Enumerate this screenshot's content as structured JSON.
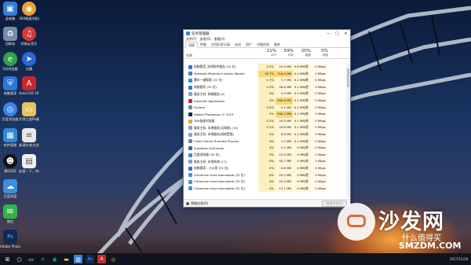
{
  "desktop_icons": [
    {
      "label": "此电脑",
      "icon": "computer-icon",
      "color": "#2f7fd8"
    },
    {
      "label": "360极速浏览器",
      "icon": "browser-360-icon",
      "color": "#e8a23a"
    },
    {
      "label": "回收站",
      "icon": "recycle-bin-icon",
      "color": "#7a8da6"
    },
    {
      "label": "网易云音乐",
      "icon": "music-icon",
      "color": "#d43c33"
    },
    {
      "label": "QQ浏览器",
      "icon": "qq-browser-icon",
      "color": "#2fa14f"
    },
    {
      "label": "迅雷",
      "icon": "thunder-icon",
      "color": "#2b67d8"
    },
    {
      "label": "电脑管家",
      "icon": "guard-icon",
      "color": "#2b77d8"
    },
    {
      "label": "AutoCAD 2016 - 简...",
      "icon": "autocad-icon",
      "color": "#c8282c"
    },
    {
      "label": "百度浏览器",
      "icon": "baidu-browser-icon",
      "color": "#3d84e8"
    },
    {
      "label": "大师之路PS素材",
      "icon": "folder-icon",
      "color": "#e8c25a"
    },
    {
      "label": "软件管理",
      "icon": "app-manager-icon",
      "color": "#2f8ad8"
    },
    {
      "label": "新建文本文档",
      "icon": "text-doc-icon",
      "color": "#e8e8e8"
    },
    {
      "label": "腾讯QQ",
      "icon": "qq-icon",
      "color": "#111111"
    },
    {
      "label": "加速一下，你就知道",
      "icon": "document-icon",
      "color": "#f0f0f0"
    },
    {
      "label": "百度网盘",
      "icon": "baidu-disk-icon",
      "color": "#3b8fe0"
    },
    {
      "label": "微信",
      "icon": "wechat-icon",
      "color": "#2fb64a"
    },
    {
      "label": "Adobe Photosh...",
      "icon": "photoshop-icon",
      "color": "#0f2a55"
    }
  ],
  "task_manager": {
    "title": "任务管理器",
    "window_buttons": [
      "—",
      "□",
      "✕"
    ],
    "menu": [
      "文件(F)",
      "选项(O)",
      "查看(V)"
    ],
    "tabs": [
      "进程",
      "性能",
      "应用历史记录",
      "启动",
      "用户",
      "详细信息",
      "服务"
    ],
    "active_tab": 0,
    "header": {
      "name_label": "名称",
      "columns": [
        {
          "pct": "21%",
          "name": "CPU"
        },
        {
          "pct": "59%",
          "name": "内存"
        },
        {
          "pct": "20%",
          "name": "磁盘"
        },
        {
          "pct": "0%",
          "name": "网络"
        }
      ]
    },
    "rows": [
      {
        "name": "电脑管家_实时防护服务 (32 位)",
        "cpu": "0.2%",
        "mem": "24.5 MB",
        "disk": "0.6 MB/秒",
        "net": "0 Mbps",
        "icon_color": "#2b77d8",
        "expand": true
      },
      {
        "name": "Windows Modules Installer Worker",
        "cpu": "18.7%",
        "mem": "116.5 MB",
        "disk": "0.4 MB/秒",
        "net": "0 Mbps",
        "icon_color": "#4a7fc0",
        "expand": false
      },
      {
        "name": "腾讯一键搜索 (32 位)",
        "cpu": "0.7%",
        "mem": "3.7 MB",
        "disk": "0.2 MB/秒",
        "net": "0 Mbps",
        "icon_color": "#3a8ad8",
        "expand": true
      },
      {
        "name": "电脑管家 (32 位)",
        "cpu": "0.3%",
        "mem": "28.8 MB",
        "disk": "0.1 MB/秒",
        "net": "0 Mbps",
        "icon_color": "#2b77d8",
        "expand": true
      },
      {
        "name": "服务主机: 网络服务 (4)",
        "cpu": "0%",
        "mem": "4.9 MB",
        "disk": "0.1 MB/秒",
        "net": "0 Mbps",
        "icon_color": "#8aa0c0",
        "expand": true
      },
      {
        "name": "AutoCAD Application",
        "cpu": "0%",
        "mem": "364.6 MB",
        "disk": "0.1 MB/秒",
        "net": "0 Mbps",
        "icon_color": "#c8282c",
        "expand": true
      },
      {
        "name": "System",
        "cpu": "0.5%",
        "mem": "0.1 MB",
        "disk": "0.1 MB/秒",
        "net": "0 Mbps",
        "icon_color": "#6688aa",
        "expand": false
      },
      {
        "name": "Adobe Photoshop CC 2015",
        "cpu": "0%",
        "mem": "590.2 MB",
        "disk": "0.1 MB/秒",
        "net": "0 Mbps",
        "icon_color": "#0f2a55",
        "expand": true
      },
      {
        "name": "360极速浏览器",
        "cpu": "0.2%",
        "mem": "24.5 MB",
        "disk": "0.1 MB/秒",
        "net": "0 Mbps",
        "icon_color": "#e8a23a",
        "expand": true
      },
      {
        "name": "服务主机: 本地服务(无网络) (10)",
        "cpu": "0.1%",
        "mem": "18.8 MB",
        "disk": "0.1 MB/秒",
        "net": "0 Mbps",
        "icon_color": "#8aa0c0",
        "expand": true
      },
      {
        "name": "服务主机: 本地服务(网络受限)",
        "cpu": "0%",
        "mem": "6.8 MB",
        "disk": "0.1 MB/秒",
        "net": "0 Mbps",
        "icon_color": "#8aa0c0",
        "expand": true
      },
      {
        "name": "Client Server Runtime Process",
        "cpu": "0%",
        "mem": "1.2 MB",
        "disk": "0.1 MB/秒",
        "net": "0 Mbps",
        "icon_color": "#6688aa",
        "expand": false
      },
      {
        "name": "Autodesk InfoCenter",
        "cpu": "0%",
        "mem": "5.2 MB",
        "disk": "0 MB/秒",
        "net": "0 Mbps",
        "icon_color": "#3a6a9a",
        "expand": false
      },
      {
        "name": "百度浏览器 (32 位)",
        "cpu": "0%",
        "mem": "15.0 MB",
        "disk": "0 MB/秒",
        "net": "0 Mbps",
        "icon_color": "#3d84e8",
        "expand": true
      },
      {
        "name": "服务主机: 本地系统 (17)",
        "cpu": "0%",
        "mem": "54.7 MB",
        "disk": "0 MB/秒",
        "net": "0 Mbps",
        "icon_color": "#8aa0c0",
        "expand": true
      },
      {
        "name": "电脑管家 - 小火箭 (32 位)",
        "cpu": "0%",
        "mem": "6.8 MB",
        "disk": "0 MB/秒",
        "net": "0 Mbps",
        "icon_color": "#2b77d8",
        "expand": false
      },
      {
        "name": "Chromium host executable (32 位)",
        "cpu": "0%",
        "mem": "25.2 MB",
        "disk": "0 MB/秒",
        "net": "0 Mbps",
        "icon_color": "#4a90e0",
        "expand": false
      },
      {
        "name": "Chromium host executable (32 位)",
        "cpu": "0%",
        "mem": "24.3 MB",
        "disk": "0 MB/秒",
        "net": "0 Mbps",
        "icon_color": "#4a90e0",
        "expand": false
      },
      {
        "name": "Chromium host executable (32 位)",
        "cpu": "0%",
        "mem": "11.1 MB",
        "disk": "0 MB/秒",
        "net": "0 Mbps",
        "icon_color": "#4a90e0",
        "expand": false
      }
    ],
    "footer": {
      "fewer_details": "简略信息(D)",
      "end_task": "结束任务(E)"
    }
  },
  "watermark": {
    "big": "沙发网",
    "small": "什么值得买",
    "domain": "SMZDM.COM"
  },
  "taskbar": {
    "apps": [
      {
        "icon": "start-icon",
        "color": "#ffffff"
      },
      {
        "icon": "search-icon",
        "color": "#ffffff"
      },
      {
        "icon": "task-view-icon",
        "color": "#ffffff"
      },
      {
        "icon": "edge-icon",
        "color": "#3a8ad8"
      },
      {
        "icon": "qq-browser-icon",
        "color": "#2fa14f"
      },
      {
        "icon": "explorer-icon",
        "color": "#e8c25a"
      },
      {
        "icon": "taskmgr-icon",
        "color": "#3c7fd6"
      },
      {
        "icon": "photoshop-icon",
        "color": "#2a6fd0"
      },
      {
        "icon": "autocad-icon",
        "color": "#c8282c"
      },
      {
        "icon": "360-icon",
        "color": "#e8a23a"
      }
    ],
    "clock_time": "",
    "clock_date": "2017/11/18"
  }
}
